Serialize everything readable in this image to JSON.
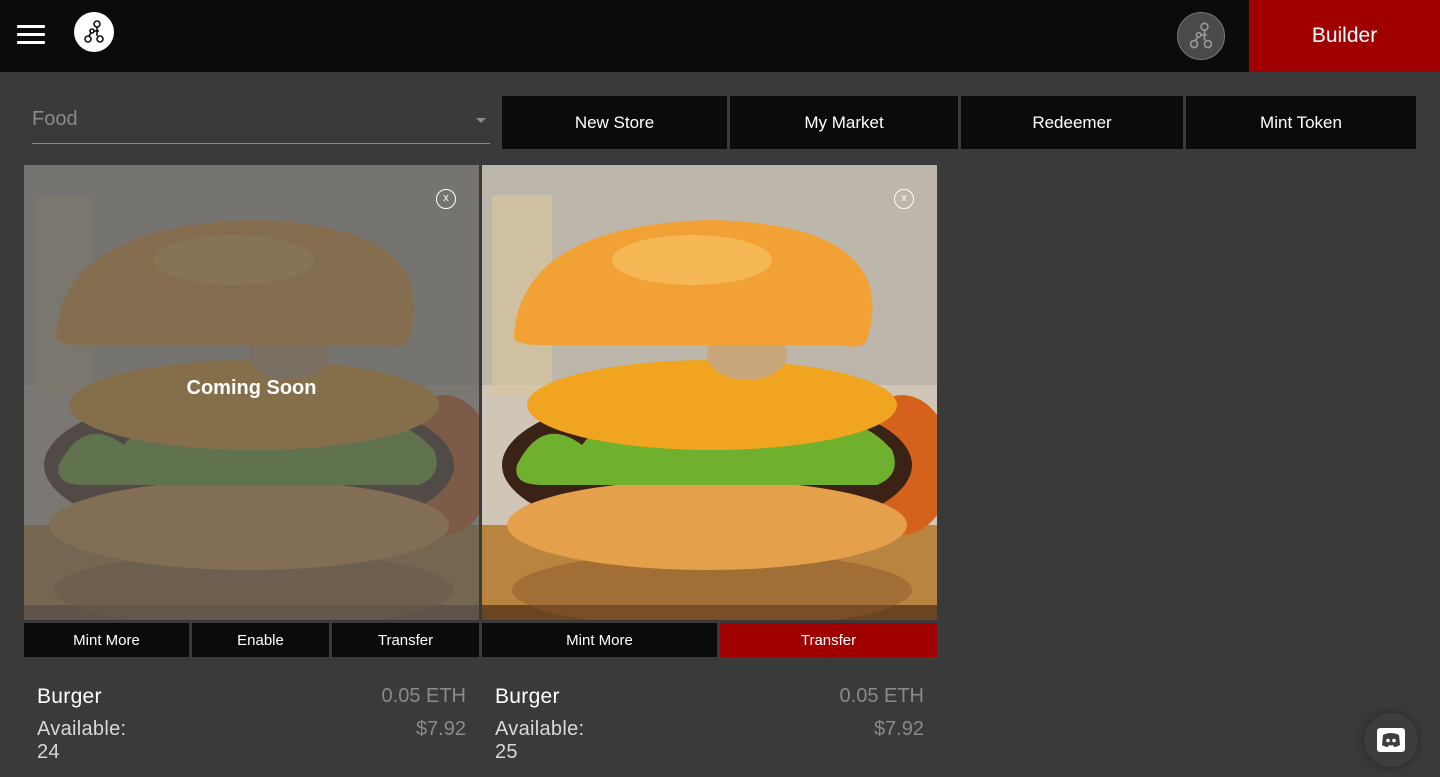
{
  "header": {
    "builder_label": "Builder"
  },
  "filters": {
    "category_value": "Food"
  },
  "nav": {
    "new_store": "New Store",
    "my_market": "My Market",
    "redeemer": "Redeemer",
    "mint_token": "Mint Token"
  },
  "cards": [
    {
      "overlay_text": "Coming Soon",
      "close_label": "x",
      "actions": [
        "Mint More",
        "Enable",
        "Transfer"
      ],
      "name": "Burger",
      "available": "Available: 24",
      "price_eth": "0.05 ETH",
      "price_usd": "$7.92"
    },
    {
      "close_label": "x",
      "actions": [
        "Mint More",
        "Transfer"
      ],
      "name": "Burger",
      "available": "Available: 25",
      "price_eth": "0.05 ETH",
      "price_usd": "$7.92"
    }
  ],
  "colors": {
    "accent_red": "#a00000",
    "topbar": "#0b0b0b",
    "background": "#3a3a3a"
  },
  "icons": [
    "menu-icon",
    "app-logo-icon",
    "profile-icon",
    "discord-icon",
    "close-icon",
    "chevron-down-icon"
  ]
}
